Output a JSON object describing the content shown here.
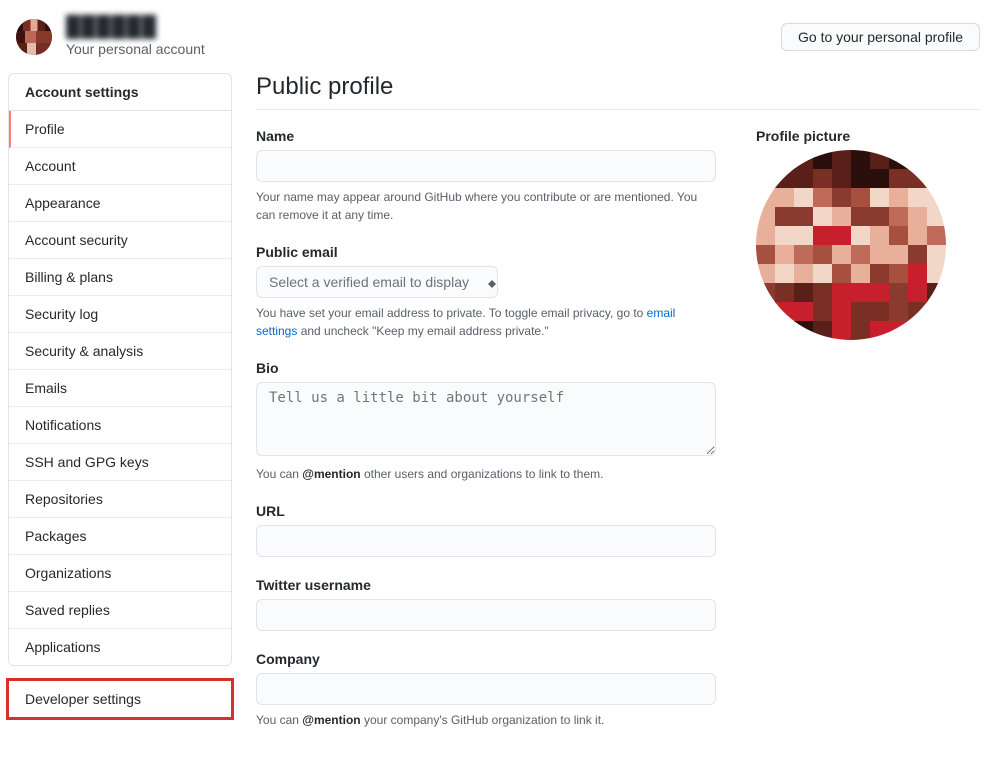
{
  "header": {
    "username": "██████",
    "subtitle": "Your personal account",
    "profile_button": "Go to your personal profile"
  },
  "sidebar": {
    "group_title": "Account settings",
    "items": [
      {
        "label": "Profile",
        "active": true
      },
      {
        "label": "Account"
      },
      {
        "label": "Appearance"
      },
      {
        "label": "Account security"
      },
      {
        "label": "Billing & plans"
      },
      {
        "label": "Security log"
      },
      {
        "label": "Security & analysis"
      },
      {
        "label": "Emails"
      },
      {
        "label": "Notifications"
      },
      {
        "label": "SSH and GPG keys"
      },
      {
        "label": "Repositories"
      },
      {
        "label": "Packages"
      },
      {
        "label": "Organizations"
      },
      {
        "label": "Saved replies"
      },
      {
        "label": "Applications"
      }
    ],
    "developer_settings": "Developer settings"
  },
  "page": {
    "title": "Public profile",
    "profile_picture_label": "Profile picture"
  },
  "fields": {
    "name": {
      "label": "Name",
      "hint": "Your name may appear around GitHub where you contribute or are mentioned. You can remove it at any time."
    },
    "public_email": {
      "label": "Public email",
      "placeholder": "Select a verified email to display",
      "hint_pre": "You have set your email address to private. To toggle email privacy, go to ",
      "hint_link": "email settings",
      "hint_post": " and uncheck \"Keep my email address private.\""
    },
    "bio": {
      "label": "Bio",
      "placeholder": "Tell us a little bit about yourself",
      "hint_pre": "You can ",
      "hint_mention": "@mention",
      "hint_post": " other users and organizations to link to them."
    },
    "url": {
      "label": "URL"
    },
    "twitter": {
      "label": "Twitter username"
    },
    "company": {
      "label": "Company",
      "hint_pre": "You can ",
      "hint_mention": "@mention",
      "hint_post": " your company's GitHub organization to link it."
    }
  }
}
